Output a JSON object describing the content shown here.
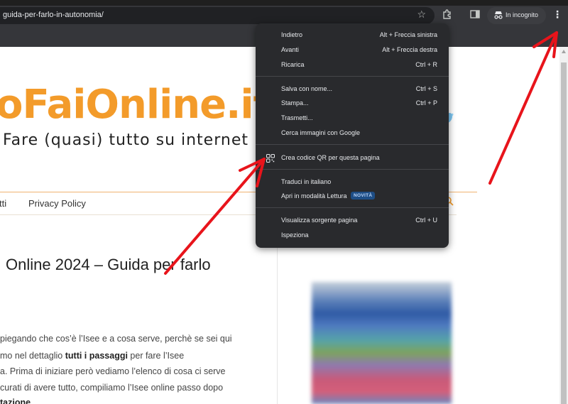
{
  "browser": {
    "url": "guida-per-farlo-in-autonomia/",
    "incognito_label": "In incognito"
  },
  "page": {
    "logo": "oFaiOnline.it",
    "tagline": "Fare (quasi) tutto su internet",
    "nav": [
      "tti",
      "Privacy Policy"
    ],
    "article_title": "Online 2024 – Guida per farlo",
    "article_lines": [
      {
        "pre": "piegando che cos’è l’Isee e a cosa serve, perchè se sei qui",
        "bold": "",
        "post": ""
      },
      {
        "pre": "mo nel dettaglio ",
        "bold": "tutti i passaggi",
        "post": " per fare l’Isee"
      },
      {
        "pre": "a. Prima di iniziare però vediamo l’elenco di cosa ci serve",
        "bold": "",
        "post": ""
      },
      {
        "pre": "curati di avere tutto, compiliamo l’Isee online passo dopo",
        "bold": "",
        "post": ""
      },
      {
        "pre": "",
        "bold": "tazione",
        "post": ""
      }
    ]
  },
  "menu": {
    "groups": [
      [
        {
          "label": "Indietro",
          "shortcut": "Alt + Freccia sinistra"
        },
        {
          "label": "Avanti",
          "shortcut": "Alt + Freccia destra"
        },
        {
          "label": "Ricarica",
          "shortcut": "Ctrl + R"
        }
      ],
      [
        {
          "label": "Salva con nome...",
          "shortcut": "Ctrl + S"
        },
        {
          "label": "Stampa...",
          "shortcut": "Ctrl + P"
        },
        {
          "label": "Trasmetti...",
          "shortcut": ""
        },
        {
          "label": "Cerca immagini con Google",
          "shortcut": ""
        }
      ],
      [
        {
          "label": "Crea codice QR per questa pagina",
          "shortcut": "",
          "icon": "qr-code-icon"
        }
      ],
      [
        {
          "label": "Traduci in italiano",
          "shortcut": ""
        },
        {
          "label": "Apri in modalità Lettura",
          "shortcut": "",
          "badge": "NOVITÀ"
        }
      ],
      [
        {
          "label": "Visualizza sorgente pagina",
          "shortcut": "Ctrl + U"
        },
        {
          "label": "Ispeziona",
          "shortcut": ""
        }
      ]
    ]
  },
  "colors": {
    "logo": "#f39b2a",
    "menu_bg": "#292a2d",
    "arrow": "#e8141b",
    "badge_bg": "#1e4e86"
  }
}
